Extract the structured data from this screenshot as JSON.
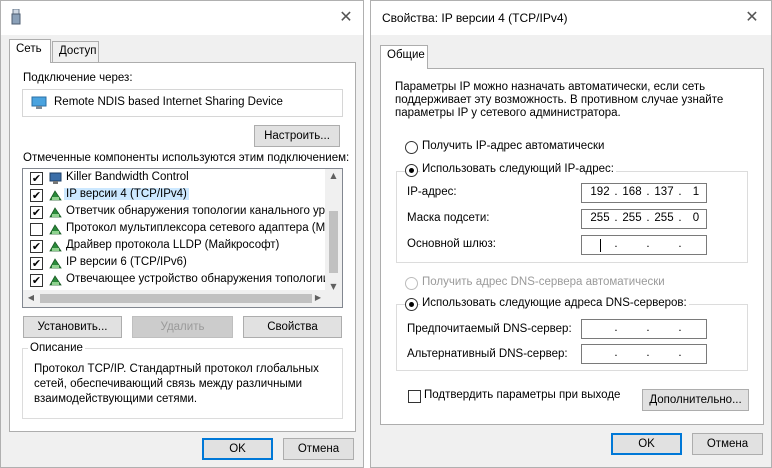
{
  "left_dialog": {
    "tabs": [
      "Сеть",
      "Доступ"
    ],
    "connect_using_label": "Подключение через:",
    "adapter_name": "Remote NDIS based Internet Sharing Device",
    "configure_button": "Настроить...",
    "components_label": "Отмеченные компоненты используются этим подключением:",
    "components": [
      {
        "label": "Killer Bandwidth Control",
        "checked": true,
        "icon": "network-service-icon",
        "selected": false
      },
      {
        "label": "IP версии 4 (TCP/IPv4)",
        "checked": true,
        "icon": "protocol-icon",
        "selected": true
      },
      {
        "label": "Ответчик обнаружения топологии канального уров",
        "checked": true,
        "icon": "protocol-icon",
        "selected": false
      },
      {
        "label": "Протокол мультиплексора сетевого адаптера (Май",
        "checked": false,
        "icon": "protocol-icon",
        "selected": false
      },
      {
        "label": "Драйвер протокола LLDP (Майкрософт)",
        "checked": true,
        "icon": "protocol-icon",
        "selected": false
      },
      {
        "label": "IP версии 6 (TCP/IPv6)",
        "checked": true,
        "icon": "protocol-icon",
        "selected": false
      },
      {
        "label": "Отвечающее устройство обнаружения топологии к",
        "checked": true,
        "icon": "protocol-icon",
        "selected": false
      }
    ],
    "install_button": "Установить...",
    "uninstall_button": "Удалить",
    "properties_button": "Свойства",
    "description_title": "Описание",
    "description_text": "Протокол TCP/IP. Стандартный протокол глобальных сетей, обеспечивающий связь между различными взаимодействующими сетями.",
    "ok_button": "OK",
    "cancel_button": "Отмена",
    "close_glyph": "✕"
  },
  "right_dialog": {
    "title": "Свойства: IP версии 4 (TCP/IPv4)",
    "tab": "Общие",
    "intro_text": "Параметры IP можно назначать автоматически, если сеть поддерживает эту возможность. В противном случае узнайте параметры IP у сетевого администратора.",
    "auto_ip_label": "Получить IP-адрес автоматически",
    "manual_ip_label": "Использовать следующий IP-адрес:",
    "ip_address_label": "IP-адрес:",
    "ip_address": [
      "192",
      "168",
      "137",
      "1"
    ],
    "subnet_label": "Маска подсети:",
    "subnet_mask": [
      "255",
      "255",
      "255",
      "0"
    ],
    "gateway_label": "Основной шлюз:",
    "gateway": [
      "",
      "",
      "",
      ""
    ],
    "auto_dns_label": "Получить адрес DNS-сервера автоматически",
    "manual_dns_label": "Использовать следующие адреса DNS-серверов:",
    "preferred_dns_label": "Предпочитаемый DNS-сервер:",
    "preferred_dns": [
      "",
      "",
      "",
      ""
    ],
    "alternate_dns_label": "Альтернативный DNS-сервер:",
    "alternate_dns": [
      "",
      "",
      "",
      ""
    ],
    "validate_label": "Подтвердить параметры при выходе",
    "advanced_button": "Дополнительно...",
    "ok_button": "OK",
    "cancel_button": "Отмена",
    "close_glyph": "✕",
    "selected_ip_mode": "manual",
    "selected_dns_mode": "manual",
    "validate_checked": false
  },
  "dot_glyph": "."
}
